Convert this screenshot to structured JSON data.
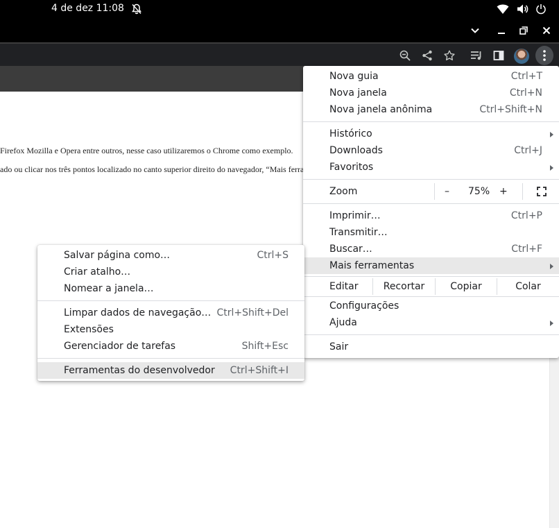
{
  "system_bar": {
    "date_time": "4 de dez  11:08"
  },
  "page_text": {
    "line1": "Firefox Mozilla e Opera entre outros, nesse caso utilizaremos o Chrome como exemplo.",
    "line2": "ado ou clicar nos três pontos localizado no canto superior direito do navegador, “Mais ferra"
  },
  "main_menu": {
    "new_tab": {
      "label": "Nova guia",
      "shortcut": "Ctrl+T"
    },
    "new_window": {
      "label": "Nova janela",
      "shortcut": "Ctrl+N"
    },
    "incognito": {
      "label": "Nova janela anônima",
      "shortcut": "Ctrl+Shift+N"
    },
    "history": {
      "label": "Histórico"
    },
    "downloads": {
      "label": "Downloads",
      "shortcut": "Ctrl+J"
    },
    "bookmarks": {
      "label": "Favoritos"
    },
    "zoom": {
      "label": "Zoom",
      "minus": "–",
      "value": "75%",
      "plus": "+"
    },
    "print": {
      "label": "Imprimir…",
      "shortcut": "Ctrl+P"
    },
    "cast": {
      "label": "Transmitir…"
    },
    "find": {
      "label": "Buscar…",
      "shortcut": "Ctrl+F"
    },
    "more_tools": {
      "label": "Mais ferramentas"
    },
    "edit": {
      "label": "Editar",
      "cut": "Recortar",
      "copy": "Copiar",
      "paste": "Colar"
    },
    "settings": {
      "label": "Configurações"
    },
    "help": {
      "label": "Ajuda"
    },
    "exit": {
      "label": "Sair"
    }
  },
  "sub_menu": {
    "save_page": {
      "label": "Salvar página como…",
      "shortcut": "Ctrl+S"
    },
    "create_shortcut": {
      "label": "Criar atalho…"
    },
    "name_window": {
      "label": "Nomear a janela…"
    },
    "clear_data": {
      "label": "Limpar dados de navegação…",
      "shortcut": "Ctrl+Shift+Del"
    },
    "extensions": {
      "label": "Extensões"
    },
    "task_manager": {
      "label": "Gerenciador de tarefas",
      "shortcut": "Shift+Esc"
    },
    "dev_tools": {
      "label": "Ferramentas do desenvolvedor",
      "shortcut": "Ctrl+Shift+I"
    }
  },
  "icons": {
    "topbar": [
      "bell-icon",
      "wifi-icon",
      "volume-icon",
      "power-icon"
    ],
    "window": [
      "chevron-down-icon",
      "minimize-icon",
      "restore-icon",
      "close-icon"
    ],
    "toolbar": [
      "zoom-out-icon",
      "share-icon",
      "star-icon",
      "media-icon",
      "side-panel-icon",
      "avatar",
      "kebab-menu-icon"
    ]
  },
  "colors": {
    "highlight": "#e8e8e8",
    "toolbar": "#202124",
    "page_header": "#3c3c3c"
  }
}
